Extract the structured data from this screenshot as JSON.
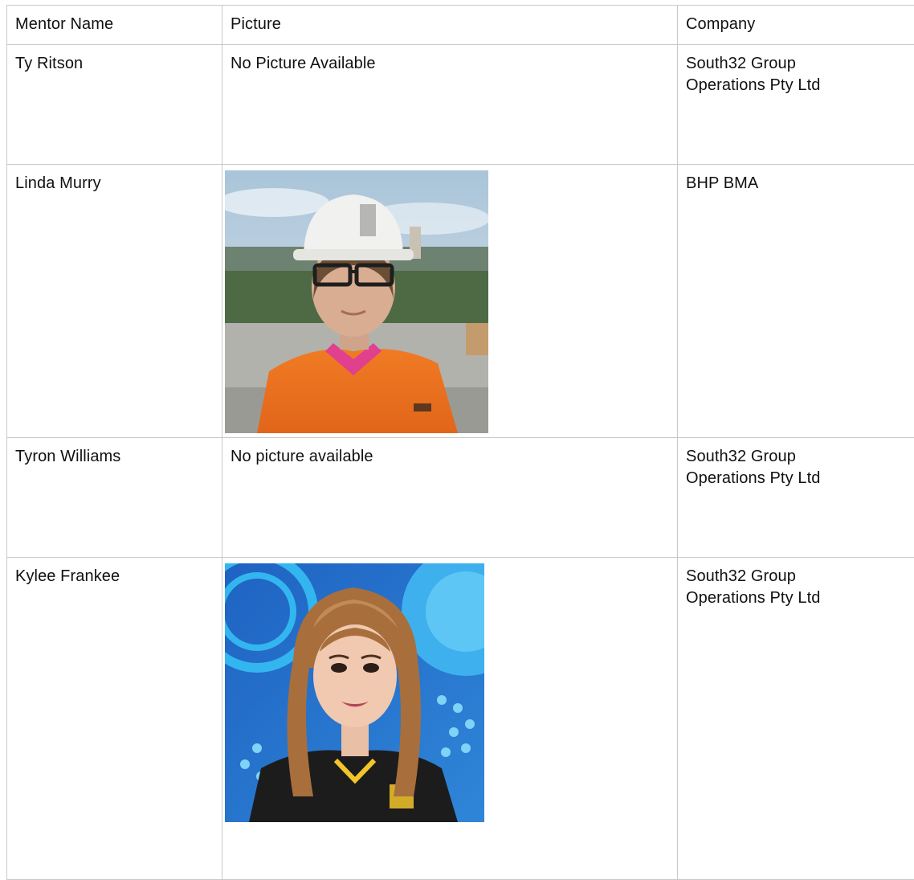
{
  "table": {
    "headers": {
      "mentor_name": "Mentor Name",
      "picture": "Picture",
      "company": "Company"
    },
    "rows": [
      {
        "mentor_name": "Ty Ritson",
        "picture_text": "No Picture Available",
        "company_line1": "South32 Group",
        "company_line2": "Operations Pty Ltd"
      },
      {
        "mentor_name": "Linda Murry",
        "picture": "photo-hardhat-orange-shirt",
        "company_line1": "BHP BMA",
        "company_line2": ""
      },
      {
        "mentor_name": "Tyron Williams",
        "picture_text": "No picture available",
        "company_line1": "South32 Group",
        "company_line2": "Operations Pty Ltd"
      },
      {
        "mentor_name": "Kylee Frankee",
        "picture": "photo-woman-blue-background",
        "company_line1": "South32 Group",
        "company_line2": "Operations Pty Ltd"
      }
    ]
  },
  "colors": {
    "border": "#c9c9c9",
    "text": "#111111"
  }
}
